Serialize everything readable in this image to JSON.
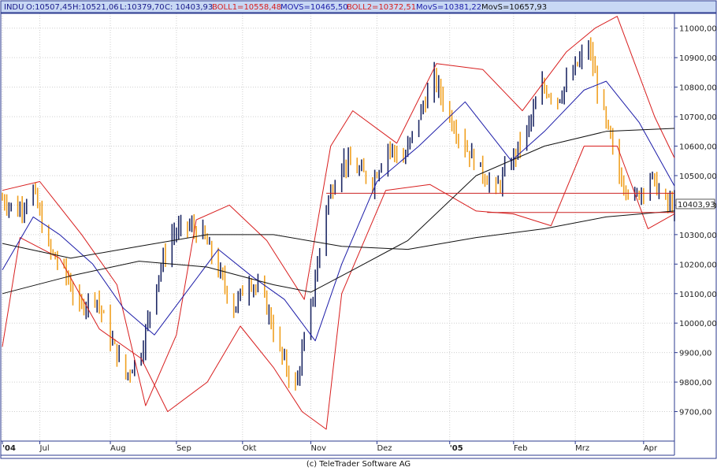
{
  "header": {
    "symbol": "INDU",
    "open": "O:10507,45",
    "high": "H:10521,06",
    "low": "L:10379,70",
    "close": "C: 10403,93",
    "boll1": "BOLL1=10558,48",
    "movs1": "MOVS=10465,50",
    "boll2": "BOLL2=10372,51",
    "movs2": "MovS=10381,22",
    "movs3": "MovS=10657,93"
  },
  "colors": {
    "frame": "#2b3a8f",
    "header_bg": "#c8d8f4",
    "bar_up": "#1f2a66",
    "bar_down": "#f0a020",
    "bollinger": "#d81e1e",
    "ma_blue": "#1c1ca8",
    "ma_black": "#111111",
    "support": "#cc2222",
    "grid": "#cfcfcf"
  },
  "footer": {
    "copyright": "(c) TeleTrader Software AG"
  },
  "chart_data": {
    "type": "candlestick",
    "y_ticks": [
      9700,
      9800,
      9900,
      10000,
      10100,
      10200,
      10300,
      10400,
      10500,
      10600,
      10700,
      10800,
      10900,
      11000
    ],
    "y_tick_labels": [
      "9700,00",
      "9800,00",
      "9900,00",
      "10000,00",
      "10100,00",
      "10200,00",
      "10300,00",
      "10400,00",
      "10500,00",
      "10600,00",
      "10700,00",
      "10800,00",
      "10900,00",
      "11000,00"
    ],
    "ylim": [
      9600,
      11050
    ],
    "x_labels": [
      "'04",
      "Jul",
      "Aug",
      "Sep",
      "Okt",
      "Nov",
      "Dez",
      "'05",
      "Feb",
      "Mrz",
      "Apr"
    ],
    "x_label_dates": [
      "2004-06-14",
      "2004-07-01",
      "2004-08-02",
      "2004-09-01",
      "2004-10-01",
      "2004-11-01",
      "2004-12-01",
      "2005-01-03",
      "2005-02-01",
      "2005-03-01",
      "2005-04-01"
    ],
    "x_range": [
      "2004-06-14",
      "2005-04-15"
    ],
    "last_price_label": "10403,93",
    "last_price": 10403.93,
    "support_lines": [
      {
        "from": "2004-11-08",
        "to": "2005-04-15",
        "y": 10440
      },
      {
        "from": "2005-01-20",
        "to": "2005-04-15",
        "y": 10375
      }
    ],
    "closes_weekly": [
      {
        "x": "2004-06-14",
        "y": 10420
      },
      {
        "x": "2004-06-21",
        "y": 10380
      },
      {
        "x": "2004-06-28",
        "y": 10450
      },
      {
        "x": "2004-07-05",
        "y": 10250
      },
      {
        "x": "2004-07-12",
        "y": 10180
      },
      {
        "x": "2004-07-19",
        "y": 10050
      },
      {
        "x": "2004-07-26",
        "y": 10100
      },
      {
        "x": "2004-08-02",
        "y": 9950
      },
      {
        "x": "2004-08-09",
        "y": 9820
      },
      {
        "x": "2004-08-16",
        "y": 9900
      },
      {
        "x": "2004-08-23",
        "y": 10150
      },
      {
        "x": "2004-08-30",
        "y": 10300
      },
      {
        "x": "2004-09-06",
        "y": 10330
      },
      {
        "x": "2004-09-13",
        "y": 10300
      },
      {
        "x": "2004-09-20",
        "y": 10180
      },
      {
        "x": "2004-09-27",
        "y": 10050
      },
      {
        "x": "2004-10-04",
        "y": 10150
      },
      {
        "x": "2004-10-11",
        "y": 10080
      },
      {
        "x": "2004-10-18",
        "y": 9900
      },
      {
        "x": "2004-10-25",
        "y": 9780
      },
      {
        "x": "2004-11-01",
        "y": 10050
      },
      {
        "x": "2004-11-08",
        "y": 10400
      },
      {
        "x": "2004-11-15",
        "y": 10550
      },
      {
        "x": "2004-11-22",
        "y": 10520
      },
      {
        "x": "2004-11-29",
        "y": 10480
      },
      {
        "x": "2004-12-06",
        "y": 10600
      },
      {
        "x": "2004-12-13",
        "y": 10550
      },
      {
        "x": "2004-12-20",
        "y": 10700
      },
      {
        "x": "2004-12-27",
        "y": 10830
      },
      {
        "x": "2005-01-03",
        "y": 10700
      },
      {
        "x": "2005-01-10",
        "y": 10600
      },
      {
        "x": "2005-01-17",
        "y": 10520
      },
      {
        "x": "2005-01-24",
        "y": 10450
      },
      {
        "x": "2005-01-31",
        "y": 10550
      },
      {
        "x": "2005-02-07",
        "y": 10650
      },
      {
        "x": "2005-02-14",
        "y": 10800
      },
      {
        "x": "2005-02-21",
        "y": 10760
      },
      {
        "x": "2005-02-28",
        "y": 10850
      },
      {
        "x": "2005-03-07",
        "y": 10940
      },
      {
        "x": "2005-03-14",
        "y": 10700
      },
      {
        "x": "2005-03-21",
        "y": 10500
      },
      {
        "x": "2005-03-28",
        "y": 10420
      },
      {
        "x": "2005-04-04",
        "y": 10500
      },
      {
        "x": "2005-04-11",
        "y": 10404
      }
    ],
    "series": [
      {
        "name": "BOLL1",
        "points": [
          {
            "x": "2004-06-14",
            "y": 10450
          },
          {
            "x": "2004-07-01",
            "y": 10480
          },
          {
            "x": "2004-07-20",
            "y": 10300
          },
          {
            "x": "2004-08-05",
            "y": 10130
          },
          {
            "x": "2004-08-18",
            "y": 9720
          },
          {
            "x": "2004-09-01",
            "y": 9960
          },
          {
            "x": "2004-09-10",
            "y": 10350
          },
          {
            "x": "2004-09-25",
            "y": 10400
          },
          {
            "x": "2004-10-12",
            "y": 10280
          },
          {
            "x": "2004-10-29",
            "y": 10080
          },
          {
            "x": "2004-11-10",
            "y": 10600
          },
          {
            "x": "2004-11-20",
            "y": 10720
          },
          {
            "x": "2004-12-10",
            "y": 10610
          },
          {
            "x": "2004-12-28",
            "y": 10880
          },
          {
            "x": "2005-01-18",
            "y": 10860
          },
          {
            "x": "2005-02-05",
            "y": 10720
          },
          {
            "x": "2005-02-25",
            "y": 10920
          },
          {
            "x": "2005-03-10",
            "y": 11000
          },
          {
            "x": "2005-03-20",
            "y": 11040
          },
          {
            "x": "2005-04-06",
            "y": 10700
          },
          {
            "x": "2005-04-15",
            "y": 10560
          }
        ]
      },
      {
        "name": "BOLL2",
        "points": [
          {
            "x": "2004-06-14",
            "y": 9920
          },
          {
            "x": "2004-06-22",
            "y": 10290
          },
          {
            "x": "2004-07-10",
            "y": 10220
          },
          {
            "x": "2004-07-28",
            "y": 9980
          },
          {
            "x": "2004-08-16",
            "y": 9880
          },
          {
            "x": "2004-08-28",
            "y": 9700
          },
          {
            "x": "2004-09-15",
            "y": 9800
          },
          {
            "x": "2004-09-30",
            "y": 9990
          },
          {
            "x": "2004-10-15",
            "y": 9850
          },
          {
            "x": "2004-10-28",
            "y": 9700
          },
          {
            "x": "2004-11-08",
            "y": 9640
          },
          {
            "x": "2004-11-15",
            "y": 10100
          },
          {
            "x": "2004-12-05",
            "y": 10450
          },
          {
            "x": "2004-12-25",
            "y": 10470
          },
          {
            "x": "2005-01-15",
            "y": 10380
          },
          {
            "x": "2005-02-01",
            "y": 10370
          },
          {
            "x": "2005-02-18",
            "y": 10330
          },
          {
            "x": "2005-03-05",
            "y": 10600
          },
          {
            "x": "2005-03-20",
            "y": 10600
          },
          {
            "x": "2005-04-03",
            "y": 10320
          },
          {
            "x": "2005-04-15",
            "y": 10370
          }
        ]
      },
      {
        "name": "MOVS",
        "points": [
          {
            "x": "2004-06-14",
            "y": 10180
          },
          {
            "x": "2004-06-28",
            "y": 10360
          },
          {
            "x": "2004-07-10",
            "y": 10300
          },
          {
            "x": "2004-07-25",
            "y": 10200
          },
          {
            "x": "2004-08-08",
            "y": 10050
          },
          {
            "x": "2004-08-22",
            "y": 9960
          },
          {
            "x": "2004-09-05",
            "y": 10100
          },
          {
            "x": "2004-09-20",
            "y": 10250
          },
          {
            "x": "2004-10-05",
            "y": 10160
          },
          {
            "x": "2004-10-20",
            "y": 10080
          },
          {
            "x": "2004-11-03",
            "y": 9940
          },
          {
            "x": "2004-11-15",
            "y": 10200
          },
          {
            "x": "2004-12-01",
            "y": 10480
          },
          {
            "x": "2004-12-20",
            "y": 10600
          },
          {
            "x": "2005-01-10",
            "y": 10750
          },
          {
            "x": "2005-01-31",
            "y": 10550
          },
          {
            "x": "2005-02-15",
            "y": 10650
          },
          {
            "x": "2005-03-05",
            "y": 10790
          },
          {
            "x": "2005-03-15",
            "y": 10820
          },
          {
            "x": "2005-03-30",
            "y": 10680
          },
          {
            "x": "2005-04-15",
            "y": 10465
          }
        ]
      },
      {
        "name": "MovS",
        "points": [
          {
            "x": "2004-06-14",
            "y": 10100
          },
          {
            "x": "2004-07-15",
            "y": 10160
          },
          {
            "x": "2004-08-15",
            "y": 10210
          },
          {
            "x": "2004-09-15",
            "y": 10190
          },
          {
            "x": "2004-10-15",
            "y": 10130
          },
          {
            "x": "2004-11-01",
            "y": 10105
          },
          {
            "x": "2004-11-20",
            "y": 10180
          },
          {
            "x": "2004-12-15",
            "y": 10280
          },
          {
            "x": "2005-01-15",
            "y": 10500
          },
          {
            "x": "2005-02-15",
            "y": 10600
          },
          {
            "x": "2005-03-15",
            "y": 10650
          },
          {
            "x": "2005-04-15",
            "y": 10660
          }
        ]
      },
      {
        "name": "MovS (200)",
        "points": [
          {
            "x": "2004-06-14",
            "y": 10270
          },
          {
            "x": "2004-07-15",
            "y": 10220
          },
          {
            "x": "2004-08-15",
            "y": 10260
          },
          {
            "x": "2004-09-15",
            "y": 10300
          },
          {
            "x": "2004-10-15",
            "y": 10300
          },
          {
            "x": "2004-11-15",
            "y": 10260
          },
          {
            "x": "2004-12-15",
            "y": 10250
          },
          {
            "x": "2005-01-15",
            "y": 10290
          },
          {
            "x": "2005-02-15",
            "y": 10320
          },
          {
            "x": "2005-03-15",
            "y": 10360
          },
          {
            "x": "2005-04-15",
            "y": 10380
          }
        ]
      }
    ]
  }
}
